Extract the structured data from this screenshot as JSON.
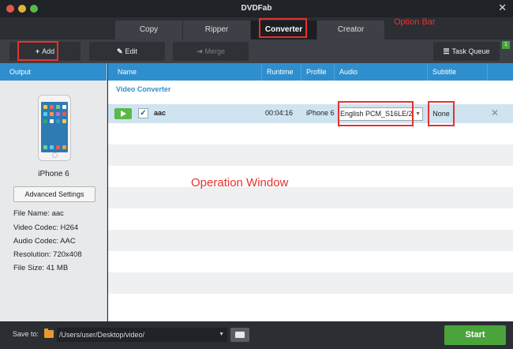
{
  "window": {
    "title": "DVDFab"
  },
  "option_bar": {
    "tabs": [
      {
        "label": "Copy",
        "active": false
      },
      {
        "label": "Ripper",
        "active": false
      },
      {
        "label": "Converter",
        "active": true
      },
      {
        "label": "Creator",
        "active": false
      }
    ],
    "annotation": "Option Bar"
  },
  "toolbar": {
    "add_label": "Add",
    "edit_label": "Edit",
    "merge_label": "Merge",
    "task_queue_label": "Task Queue",
    "task_queue_badge": "1"
  },
  "left_panel": {
    "header": "Output",
    "device_name": "iPhone 6",
    "advanced_settings_label": "Advanced Settings",
    "info": [
      "File Name: aac",
      "Video Codec: H264",
      "Audio Codec: AAC",
      "Resolution: 720x408",
      "File Size: 41 MB"
    ]
  },
  "table": {
    "columns": [
      "Name",
      "Runtime",
      "Profile",
      "Audio",
      "Subtitle"
    ],
    "group_label": "Video Converter",
    "row": {
      "name": "aac",
      "runtime": "00:04:16",
      "profile": "iPhone 6",
      "audio": "English PCM_S16LE/2",
      "subtitle": "None",
      "checked": true
    }
  },
  "annotations": {
    "operation_window": "Operation Window"
  },
  "bottom_bar": {
    "save_to_label": "Save to:",
    "save_path": "/Users/user/Desktop/video/",
    "start_label": "Start"
  },
  "colors": {
    "accent_blue": "#2f8fce",
    "start_green": "#4aa33b",
    "annotation_red": "#e8312c",
    "row_highlight": "#cfe3f1"
  },
  "icons": [
    "plus-icon",
    "edit-icon",
    "merge-icon",
    "task-queue-icon",
    "play-icon",
    "checkbox-icon",
    "close-icon",
    "folder-icon",
    "dropdown-arrow-icon"
  ]
}
